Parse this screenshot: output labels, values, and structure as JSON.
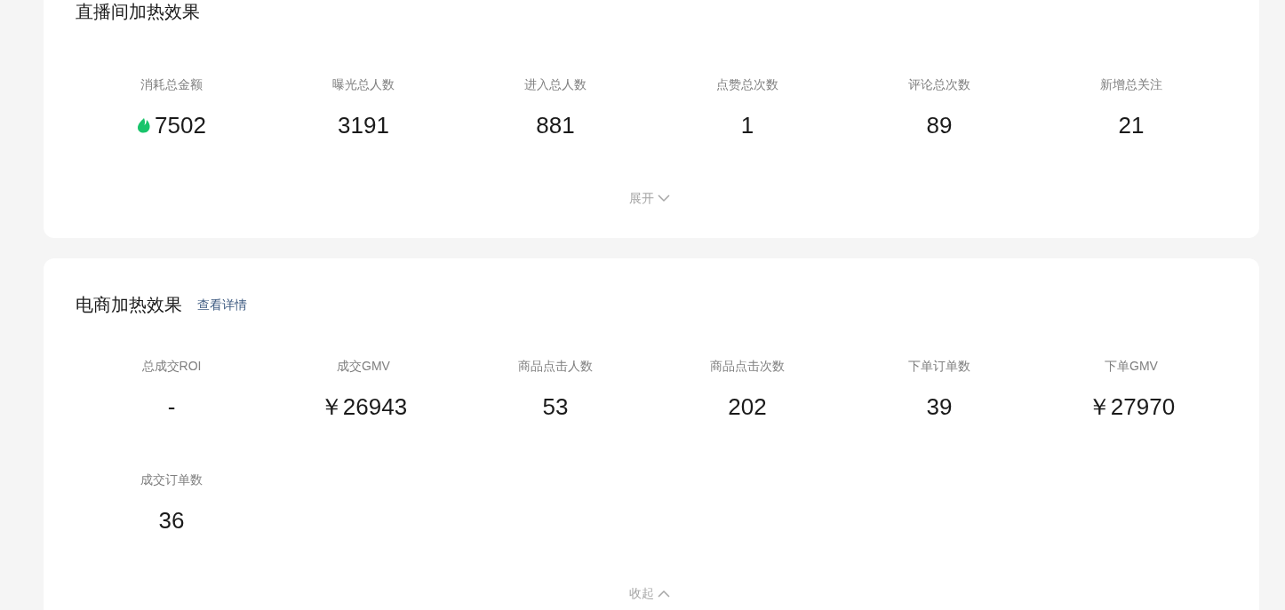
{
  "cards": [
    {
      "title": "直播间加热效果",
      "metrics": [
        {
          "label": "消耗总金额",
          "value": "7502",
          "kind": "coin"
        },
        {
          "label": "曝光总人数",
          "value": "3191",
          "kind": "plain"
        },
        {
          "label": "进入总人数",
          "value": "881",
          "kind": "plain"
        },
        {
          "label": "点赞总次数",
          "value": "1",
          "kind": "plain"
        },
        {
          "label": "评论总次数",
          "value": "89",
          "kind": "plain"
        },
        {
          "label": "新增总关注",
          "value": "21",
          "kind": "plain"
        }
      ],
      "toggle": {
        "label": "展开",
        "expanded": false
      }
    },
    {
      "title": "电商加热效果",
      "link": "查看详情",
      "metrics": [
        {
          "label": "总成交ROI",
          "value": "-",
          "kind": "plain"
        },
        {
          "label": "成交GMV",
          "value": "￥26943",
          "kind": "plain"
        },
        {
          "label": "商品点击人数",
          "value": "53",
          "kind": "plain"
        },
        {
          "label": "商品点击次数",
          "value": "202",
          "kind": "plain"
        },
        {
          "label": "下单订单数",
          "value": "39",
          "kind": "plain"
        },
        {
          "label": "下单GMV",
          "value": "￥27970",
          "kind": "plain"
        },
        {
          "label": "成交订单数",
          "value": "36",
          "kind": "plain"
        }
      ],
      "toggle": {
        "label": "收起",
        "expanded": true
      }
    }
  ]
}
